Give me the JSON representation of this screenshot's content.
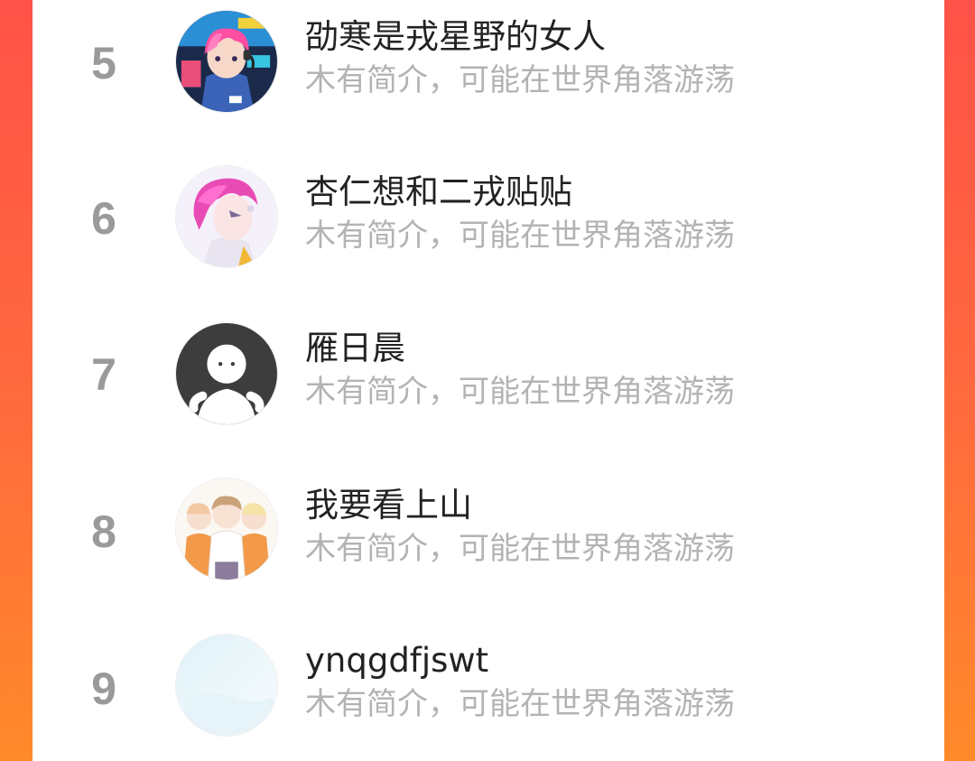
{
  "colors": {
    "background_gradient_top": "#ff5248",
    "background_gradient_bottom": "#ff8a2a",
    "rank": "#9a9a9a",
    "name": "#222222",
    "bio": "#b3b3b3"
  },
  "ranking": {
    "items": [
      {
        "rank": "5",
        "name": "劭寒是戎星野的女人",
        "bio": "木有简介，可能在世界角落游荡",
        "avatar_icon": "anime-boy-pink-hair-headset-avatar"
      },
      {
        "rank": "6",
        "name": "杏仁想和二戎贴贴",
        "bio": "木有简介，可能在世界角落游荡",
        "avatar_icon": "anime-boy-pink-hair-avatar"
      },
      {
        "rank": "7",
        "name": "雁日晨",
        "bio": "木有简介，可能在世界角落游荡",
        "avatar_icon": "default-white-figure-avatar"
      },
      {
        "rank": "8",
        "name": "我要看上山",
        "bio": "木有简介，可能在世界角落游荡",
        "avatar_icon": "three-chibi-boys-avatar"
      },
      {
        "rank": "9",
        "name": "ynqgdfjswt",
        "bio": "木有简介，可能在世界角落游荡",
        "avatar_icon": "light-blue-blank-avatar"
      }
    ]
  }
}
